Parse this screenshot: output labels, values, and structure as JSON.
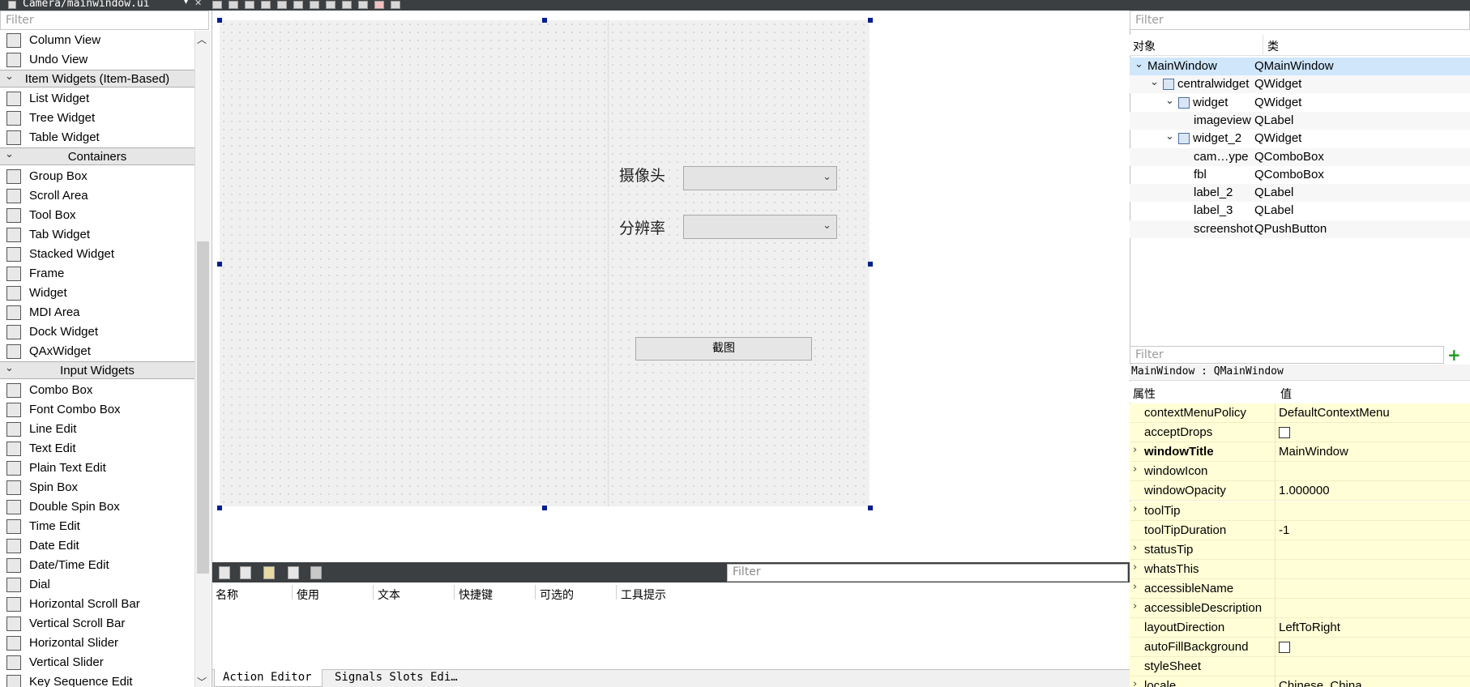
{
  "titlebar": {
    "tab_title": "Camera/mainwindow.ui",
    "close_glyph": "✕"
  },
  "widget_box": {
    "filter_placeholder": "Filter",
    "rows": [
      {
        "kind": "item",
        "label": "Column View",
        "icon": "column-view-icon"
      },
      {
        "kind": "item",
        "label": "Undo View",
        "icon": "undo-view-icon"
      },
      {
        "kind": "cat",
        "label": "Item Widgets (Item-Based)"
      },
      {
        "kind": "item",
        "label": "List Widget",
        "icon": "list-widget-icon"
      },
      {
        "kind": "item",
        "label": "Tree Widget",
        "icon": "tree-widget-icon"
      },
      {
        "kind": "item",
        "label": "Table Widget",
        "icon": "table-widget-icon"
      },
      {
        "kind": "cat",
        "label": "Containers"
      },
      {
        "kind": "item",
        "label": "Group Box",
        "icon": "group-box-icon"
      },
      {
        "kind": "item",
        "label": "Scroll Area",
        "icon": "scroll-area-icon"
      },
      {
        "kind": "item",
        "label": "Tool Box",
        "icon": "tool-box-icon"
      },
      {
        "kind": "item",
        "label": "Tab Widget",
        "icon": "tab-widget-icon"
      },
      {
        "kind": "item",
        "label": "Stacked Widget",
        "icon": "stacked-widget-icon"
      },
      {
        "kind": "item",
        "label": "Frame",
        "icon": "frame-icon"
      },
      {
        "kind": "item",
        "label": "Widget",
        "icon": "widget-icon"
      },
      {
        "kind": "item",
        "label": "MDI Area",
        "icon": "mdi-area-icon"
      },
      {
        "kind": "item",
        "label": "Dock Widget",
        "icon": "dock-widget-icon"
      },
      {
        "kind": "item",
        "label": "QAxWidget",
        "icon": "qaxwidget-icon"
      },
      {
        "kind": "cat",
        "label": "Input Widgets"
      },
      {
        "kind": "item",
        "label": "Combo Box",
        "icon": "combo-box-icon"
      },
      {
        "kind": "item",
        "label": "Font Combo Box",
        "icon": "font-combo-box-icon"
      },
      {
        "kind": "item",
        "label": "Line Edit",
        "icon": "line-edit-icon"
      },
      {
        "kind": "item",
        "label": "Text Edit",
        "icon": "text-edit-icon"
      },
      {
        "kind": "item",
        "label": "Plain Text Edit",
        "icon": "plain-text-edit-icon"
      },
      {
        "kind": "item",
        "label": "Spin Box",
        "icon": "spin-box-icon"
      },
      {
        "kind": "item",
        "label": "Double Spin Box",
        "icon": "double-spin-box-icon"
      },
      {
        "kind": "item",
        "label": "Time Edit",
        "icon": "time-edit-icon"
      },
      {
        "kind": "item",
        "label": "Date Edit",
        "icon": "date-edit-icon"
      },
      {
        "kind": "item",
        "label": "Date/Time Edit",
        "icon": "date-time-edit-icon"
      },
      {
        "kind": "item",
        "label": "Dial",
        "icon": "dial-icon"
      },
      {
        "kind": "item",
        "label": "Horizontal Scroll Bar",
        "icon": "horizontal-scroll-bar-icon"
      },
      {
        "kind": "item",
        "label": "Vertical Scroll Bar",
        "icon": "vertical-scroll-bar-icon"
      },
      {
        "kind": "item",
        "label": "Horizontal Slider",
        "icon": "horizontal-slider-icon"
      },
      {
        "kind": "item",
        "label": "Vertical Slider",
        "icon": "vertical-slider-icon"
      },
      {
        "kind": "item",
        "label": "Key Sequence Edit",
        "icon": "key-sequence-edit-icon"
      }
    ]
  },
  "form": {
    "camera_label": "摄像头",
    "resolution_label": "分辨率",
    "camera_combo_value": "",
    "resolution_combo_value": "",
    "screenshot_button": "截图",
    "combo_arrow": "⌄"
  },
  "action_editor": {
    "filter_placeholder": "Filter",
    "columns": [
      "名称",
      "使用",
      "文本",
      "快捷键",
      "可选的",
      "工具提示"
    ],
    "tabs": [
      "Action Editor",
      "Signals  Slots Edi…"
    ]
  },
  "object_inspector": {
    "filter_placeholder": "Filter",
    "header_object": "对象",
    "header_class": "类",
    "rows": [
      {
        "name": "MainWindow",
        "class": "QMainWindow",
        "expanded": true,
        "selected": true
      },
      {
        "name": "centralwidget",
        "class": "QWidget",
        "expanded": true
      },
      {
        "name": "widget",
        "class": "QWidget",
        "expanded": true
      },
      {
        "name": "imageview",
        "class": "QLabel"
      },
      {
        "name": "widget_2",
        "class": "QWidget",
        "expanded": true
      },
      {
        "name": "cam…ype",
        "class": "QComboBox"
      },
      {
        "name": "fbl",
        "class": "QComboBox"
      },
      {
        "name": "label_2",
        "class": "QLabel"
      },
      {
        "name": "label_3",
        "class": "QLabel"
      },
      {
        "name": "screenshot",
        "class": "QPushButton"
      }
    ]
  },
  "property_editor": {
    "filter_placeholder": "Filter",
    "object_label": "MainWindow : QMainWindow",
    "header_property": "属性",
    "header_value": "值",
    "add_glyph": "+",
    "rows": [
      {
        "name": "contextMenuPolicy",
        "value": "DefaultContextMenu"
      },
      {
        "name": "acceptDrops",
        "checkbox": true,
        "checked": false
      },
      {
        "name": "windowTitle",
        "value": "MainWindow",
        "expandable": true,
        "bold": true
      },
      {
        "name": "windowIcon",
        "value": "",
        "expandable": true
      },
      {
        "name": "windowOpacity",
        "value": "1.000000"
      },
      {
        "name": "toolTip",
        "value": "",
        "expandable": true
      },
      {
        "name": "toolTipDuration",
        "value": "-1"
      },
      {
        "name": "statusTip",
        "value": "",
        "expandable": true
      },
      {
        "name": "whatsThis",
        "value": "",
        "expandable": true
      },
      {
        "name": "accessibleName",
        "value": "",
        "expandable": true
      },
      {
        "name": "accessibleDescription",
        "value": "",
        "expandable": true
      },
      {
        "name": "layoutDirection",
        "value": "LeftToRight"
      },
      {
        "name": "autoFillBackground",
        "checkbox": true,
        "checked": false
      },
      {
        "name": "styleSheet",
        "value": ""
      },
      {
        "name": "locale",
        "value": "Chinese, China",
        "expandable": true
      }
    ]
  }
}
